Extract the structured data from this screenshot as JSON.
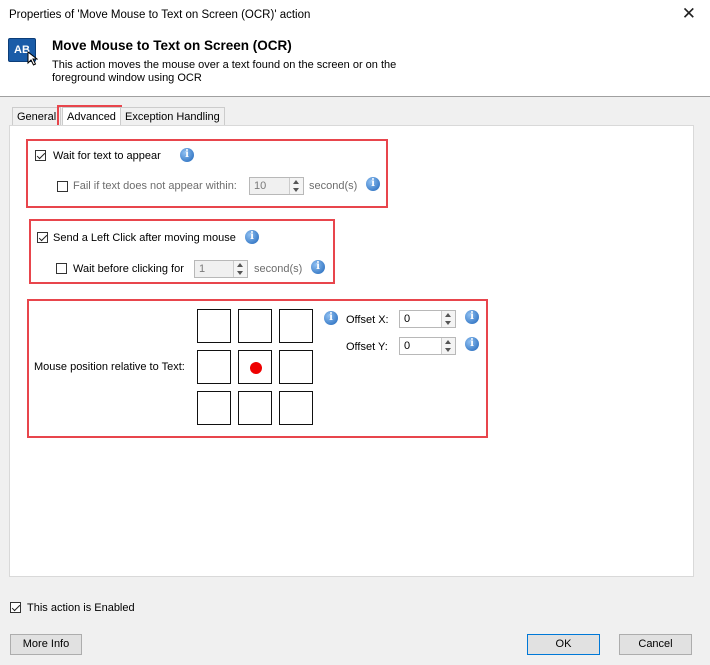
{
  "window": {
    "title": "Properties of 'Move Mouse to Text on Screen (OCR)' action",
    "close_glyph": "✕"
  },
  "header": {
    "icon_text": "AB",
    "title": "Move Mouse to Text on Screen (OCR)",
    "description": "This action moves the mouse over a text found on the screen or on the foreground window using OCR"
  },
  "tabs": [
    {
      "label": "General"
    },
    {
      "label": "Advanced",
      "active": true
    },
    {
      "label": "Exception Handling"
    }
  ],
  "wait_group": {
    "wait_label": "Wait for text to appear",
    "wait_checked": true,
    "fail_label": "Fail if text does not appear within:",
    "fail_checked": false,
    "fail_value": "10",
    "fail_unit": "second(s)"
  },
  "click_group": {
    "click_label": "Send a Left Click after moving mouse",
    "click_checked": true,
    "wait_label": "Wait before clicking for",
    "wait_checked": false,
    "wait_value": "1",
    "wait_unit": "second(s)"
  },
  "position_group": {
    "label": "Mouse position relative to Text:",
    "selected_cell": "middle-center",
    "offset_x_label": "Offset X:",
    "offset_x_value": "0",
    "offset_y_label": "Offset Y:",
    "offset_y_value": "0"
  },
  "footer": {
    "enabled_label": "This action is Enabled",
    "enabled_checked": true,
    "more_info_label": "More Info",
    "ok_label": "OK",
    "cancel_label": "Cancel"
  },
  "colors": {
    "highlight_box": "#e8454c",
    "selected_dot": "#ee0000",
    "info_icon": "#1d64b8"
  },
  "icons": [
    "close-icon",
    "action-icon",
    "cursor-icon",
    "info-icon",
    "checkbox-icon"
  ]
}
